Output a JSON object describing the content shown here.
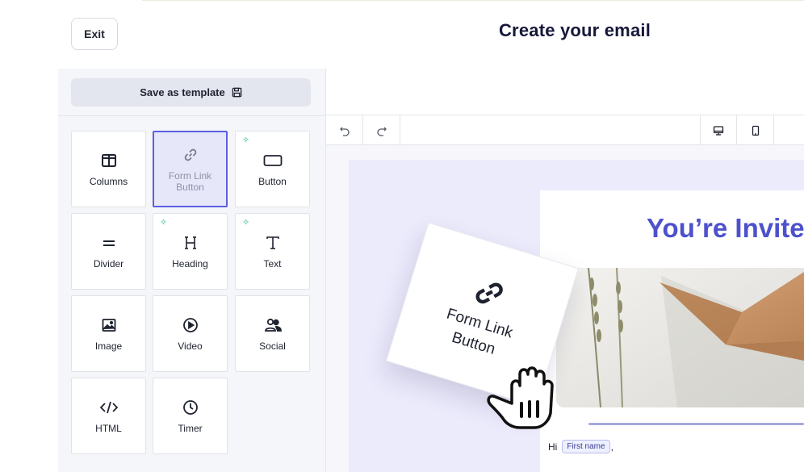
{
  "header": {
    "exit_label": "Exit",
    "title": "Create your email"
  },
  "sidebar": {
    "save_template_label": "Save as template",
    "save_template_icon": "floppy-disk-icon",
    "blocks": [
      {
        "label": "Columns",
        "icon": "columns-icon",
        "selected": false,
        "new": false
      },
      {
        "label": "Form Link Button",
        "icon": "link-icon",
        "selected": true,
        "new": false
      },
      {
        "label": "Button",
        "icon": "button-icon",
        "selected": false,
        "new": true
      },
      {
        "label": "Divider",
        "icon": "divider-icon",
        "selected": false,
        "new": false
      },
      {
        "label": "Heading",
        "icon": "heading-icon",
        "selected": false,
        "new": true
      },
      {
        "label": "Text",
        "icon": "text-icon",
        "selected": false,
        "new": true
      },
      {
        "label": "Image",
        "icon": "image-icon",
        "selected": false,
        "new": false
      },
      {
        "label": "Video",
        "icon": "play-circle-icon",
        "selected": false,
        "new": false
      },
      {
        "label": "Social",
        "icon": "people-icon",
        "selected": false,
        "new": false
      },
      {
        "label": "HTML",
        "icon": "code-icon",
        "selected": false,
        "new": false
      },
      {
        "label": "Timer",
        "icon": "clock-icon",
        "selected": false,
        "new": false
      }
    ]
  },
  "toolbar": {
    "undo_icon": "undo-icon",
    "redo_icon": "redo-icon",
    "desktop_icon": "desktop-icon",
    "mobile_icon": "mobile-icon"
  },
  "email": {
    "heading": "You’re Invite",
    "greeting": "Hi",
    "merge_tag": "First name",
    "punctuation": ","
  },
  "drag_preview": {
    "label_line1": "Form Link",
    "label_line2": "Button"
  },
  "colors": {
    "accent": "#5b5fe0",
    "heading": "#4d51cc",
    "new_badge": "#2bb38a"
  }
}
